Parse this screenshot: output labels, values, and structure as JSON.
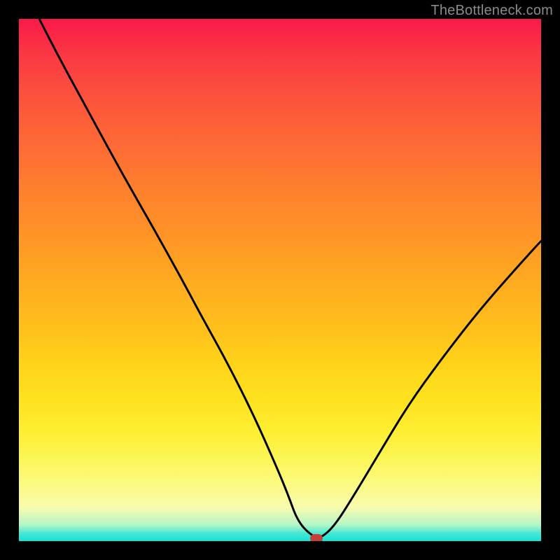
{
  "watermark": {
    "text": "TheBottleneck.com"
  },
  "chart_data": {
    "type": "line",
    "title": "",
    "xlabel": "",
    "ylabel": "",
    "xlim": [
      0,
      100
    ],
    "ylim": [
      0,
      100
    ],
    "gradient_stops": [
      {
        "pct": 0,
        "color": "#f91a4a"
      },
      {
        "pct": 6,
        "color": "#fb3444"
      },
      {
        "pct": 13,
        "color": "#fc4c3e"
      },
      {
        "pct": 20,
        "color": "#fd6038"
      },
      {
        "pct": 27,
        "color": "#fe7133"
      },
      {
        "pct": 33,
        "color": "#fe812d"
      },
      {
        "pct": 40,
        "color": "#ff9028"
      },
      {
        "pct": 46,
        "color": "#ffa023"
      },
      {
        "pct": 53,
        "color": "#ffb11f"
      },
      {
        "pct": 60,
        "color": "#ffc21b"
      },
      {
        "pct": 66,
        "color": "#ffd31a"
      },
      {
        "pct": 73,
        "color": "#fee21f"
      },
      {
        "pct": 79,
        "color": "#feee32"
      },
      {
        "pct": 84,
        "color": "#fcf654"
      },
      {
        "pct": 89,
        "color": "#fbfa81"
      },
      {
        "pct": 93.5,
        "color": "#f8fbad"
      },
      {
        "pct": 96.8,
        "color": "#b7f6c6"
      },
      {
        "pct": 98.5,
        "color": "#4ae7d2"
      },
      {
        "pct": 100,
        "color": "#12e3d6"
      }
    ],
    "series": [
      {
        "name": "bottleneck-curve",
        "color": "#000000",
        "x": [
          3.9,
          8.0,
          14.0,
          20.0,
          26.0,
          31.0,
          35.0,
          40.0,
          45.0,
          49.0,
          51.5,
          53.5,
          56.5,
          58.0,
          60.5,
          64.0,
          68.5,
          74.5,
          81.0,
          88.0,
          95.0,
          100.0
        ],
        "values": [
          100.0,
          92.0,
          81.0,
          70.0,
          59.5,
          50.5,
          43.0,
          34.0,
          24.0,
          15.0,
          9.0,
          3.5,
          0.7,
          0.7,
          3.0,
          8.5,
          16.0,
          26.0,
          35.0,
          44.0,
          52.0,
          57.5
        ]
      }
    ],
    "marker": {
      "x": 57.0,
      "y": 0.5,
      "color": "#c73f3a"
    }
  }
}
